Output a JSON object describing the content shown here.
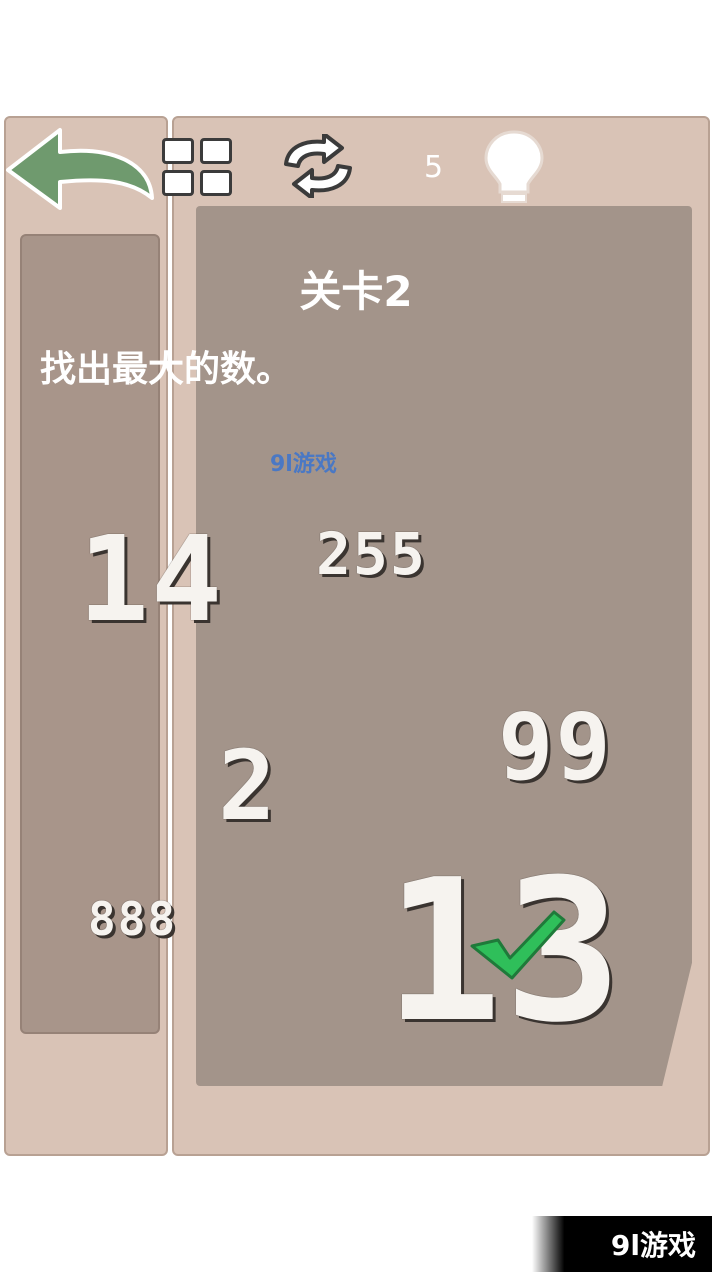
{
  "toolbar": {
    "hint_count": "5"
  },
  "level": {
    "title": "关卡2",
    "instruction": "找出最大的数。"
  },
  "numbers": {
    "n14": "14",
    "n255": "255",
    "n99": "99",
    "n2": "2",
    "n888": "888",
    "n13": "13"
  },
  "watermark": {
    "center": "9l游戏",
    "bottom": "9l游戏"
  },
  "icons": {
    "back": "back-arrow-icon",
    "grid": "level-grid-icon",
    "refresh": "refresh-icon",
    "hint": "lightbulb-icon",
    "check": "checkmark-icon"
  },
  "colors": {
    "board": "#d9c3b6",
    "inner": "#a3948a",
    "back_arrow": "#6f9a6e",
    "check": "#2fbf5a"
  }
}
